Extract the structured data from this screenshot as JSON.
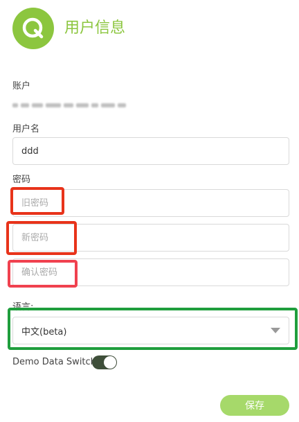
{
  "header": {
    "title": "用户信息",
    "logo_icon": "q-logo-icon"
  },
  "account": {
    "label": "账户"
  },
  "username": {
    "label": "用户名",
    "value": "ddd"
  },
  "password": {
    "label": "密码",
    "old_placeholder": "旧密码",
    "new_placeholder": "新密码",
    "confirm_placeholder": "确认密码"
  },
  "language": {
    "label": "语言:",
    "selected": "中文(beta)"
  },
  "demo_switch": {
    "label": "Demo Data Switch:",
    "on": true
  },
  "actions": {
    "save_label": "保存"
  },
  "colors": {
    "brand": "#8cc63f",
    "save_button": "#a6d96a",
    "highlight_red": "#e8331a",
    "highlight_pink": "#f0414f",
    "highlight_green": "#1f9e3d"
  }
}
